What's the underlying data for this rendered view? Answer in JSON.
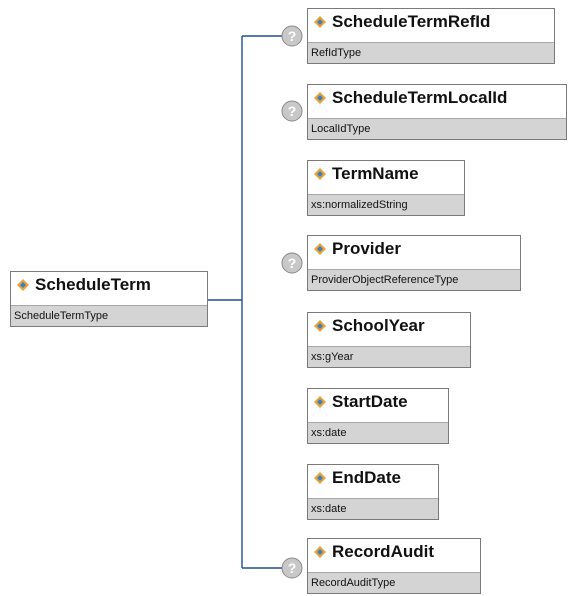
{
  "root": {
    "name": "ScheduleTerm",
    "type": "ScheduleTermType"
  },
  "children": [
    {
      "name": "ScheduleTermRefId",
      "type": "RefIdType",
      "optional": true
    },
    {
      "name": "ScheduleTermLocalId",
      "type": "LocalIdType",
      "optional": true
    },
    {
      "name": "TermName",
      "type": "xs:normalizedString",
      "optional": false
    },
    {
      "name": "Provider",
      "type": "ProviderObjectReferenceType",
      "optional": true
    },
    {
      "name": "SchoolYear",
      "type": "xs:gYear",
      "optional": false
    },
    {
      "name": "StartDate",
      "type": "xs:date",
      "optional": false
    },
    {
      "name": "EndDate",
      "type": "xs:date",
      "optional": false
    },
    {
      "name": "RecordAudit",
      "type": "RecordAuditType",
      "optional": true
    }
  ],
  "optional_badge_glyph": "?",
  "colors": {
    "connector": "#1f4f8f",
    "icon_gold": "#e8a33a",
    "icon_blue": "#3f7fc0",
    "badge_fill": "#c8c8c8",
    "node_border": "#7a7a7a",
    "type_background": "#d4d4d4"
  }
}
